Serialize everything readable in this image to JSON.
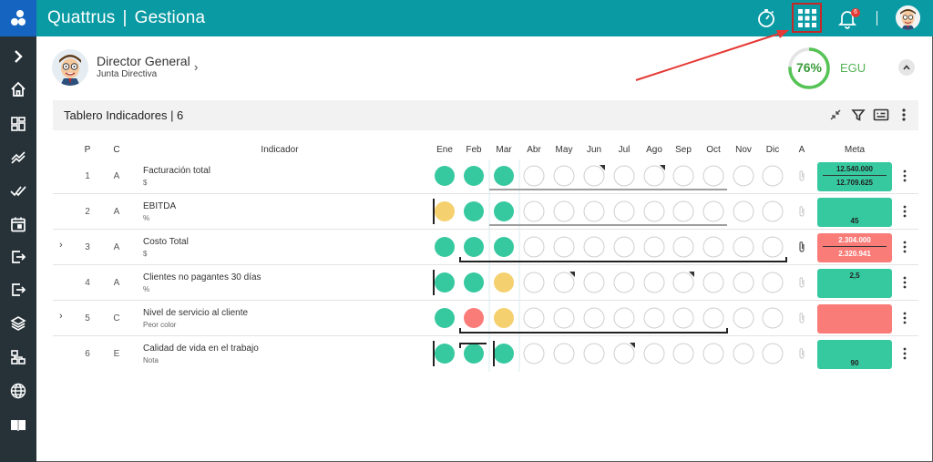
{
  "app": {
    "brand": "Quattrus",
    "module": "Gestiona",
    "brand_separator": "|",
    "notification_count": "6"
  },
  "icons": {
    "topbar": [
      "timer-icon",
      "apps-grid-icon",
      "bell-icon",
      "user-avatar"
    ],
    "sidebar": [
      "chevron-right-icon",
      "home-icon",
      "dashboard-icon",
      "trend-icon",
      "double-check-icon",
      "calendar-icon",
      "exit-icon",
      "logout-icon",
      "layers-icon",
      "sitemap-icon",
      "globe-icon",
      "book-icon"
    ]
  },
  "profile": {
    "role": "Director General",
    "department": "Junta Directiva",
    "score": "76%",
    "score_value": 0.76,
    "score_label": "EGU"
  },
  "panel": {
    "title": "Tablero Indicadores | 6"
  },
  "table": {
    "headers": {
      "p": "P",
      "c": "C",
      "indicator": "Indicador",
      "a": "A",
      "meta": "Meta"
    },
    "months": [
      "Ene",
      "Feb",
      "Mar",
      "Abr",
      "May",
      "Jun",
      "Jul",
      "Ago",
      "Sep",
      "Oct",
      "Nov",
      "Dic"
    ],
    "rows": [
      {
        "p": "1",
        "c": "A",
        "name": "Facturación total",
        "unit": "$",
        "statuses": [
          "green",
          "green",
          "green",
          "empty",
          "empty",
          "empty",
          "empty",
          "empty",
          "empty",
          "empty",
          "empty",
          "empty"
        ],
        "meta_top": "12.540.000",
        "meta_bottom": "12.709.625",
        "meta_color": "#36c9a0"
      },
      {
        "p": "2",
        "c": "A",
        "name": "EBITDA",
        "unit": "%",
        "statuses": [
          "yellow",
          "green",
          "green",
          "empty",
          "empty",
          "empty",
          "empty",
          "empty",
          "empty",
          "empty",
          "empty",
          "empty"
        ],
        "meta_top": "",
        "meta_bottom": "45",
        "meta_color": "#36c9a0"
      },
      {
        "p": "3",
        "c": "A",
        "name": "Costo Total",
        "unit": "$",
        "statuses": [
          "green",
          "green",
          "green",
          "empty",
          "empty",
          "empty",
          "empty",
          "empty",
          "empty",
          "empty",
          "empty",
          "empty"
        ],
        "meta_top": "2.304.000",
        "meta_bottom": "2.320.941",
        "meta_color": "#fa7c78"
      },
      {
        "p": "4",
        "c": "A",
        "name": "Clientes no pagantes 30 días",
        "unit": "%",
        "statuses": [
          "green",
          "green",
          "yellow",
          "empty",
          "empty",
          "empty",
          "empty",
          "empty",
          "empty",
          "empty",
          "empty",
          "empty"
        ],
        "meta_top": "2,5",
        "meta_bottom": "",
        "meta_color": "#36c9a0"
      },
      {
        "p": "5",
        "c": "C",
        "name": "Nivel de servicio al cliente",
        "unit": "Peor color",
        "statuses": [
          "green",
          "red",
          "yellow",
          "empty",
          "empty",
          "empty",
          "empty",
          "empty",
          "empty",
          "empty",
          "empty",
          "empty"
        ],
        "meta_top": "",
        "meta_bottom": "",
        "meta_color": "#fa7c78"
      },
      {
        "p": "6",
        "c": "E",
        "name": "Calidad de vida en el trabajo",
        "unit": "Nota",
        "statuses": [
          "green",
          "green",
          "green",
          "empty",
          "empty",
          "empty",
          "empty",
          "empty",
          "empty",
          "empty",
          "empty",
          "empty"
        ],
        "meta_top": "",
        "meta_bottom": "90",
        "meta_color": "#36c9a0"
      }
    ]
  },
  "colors": {
    "topbar": "#0a9aa3",
    "sidebar": "#263238",
    "green": "#36c9a0",
    "yellow": "#f5d06e",
    "red": "#fa7c78",
    "annotation": "#e53935"
  }
}
